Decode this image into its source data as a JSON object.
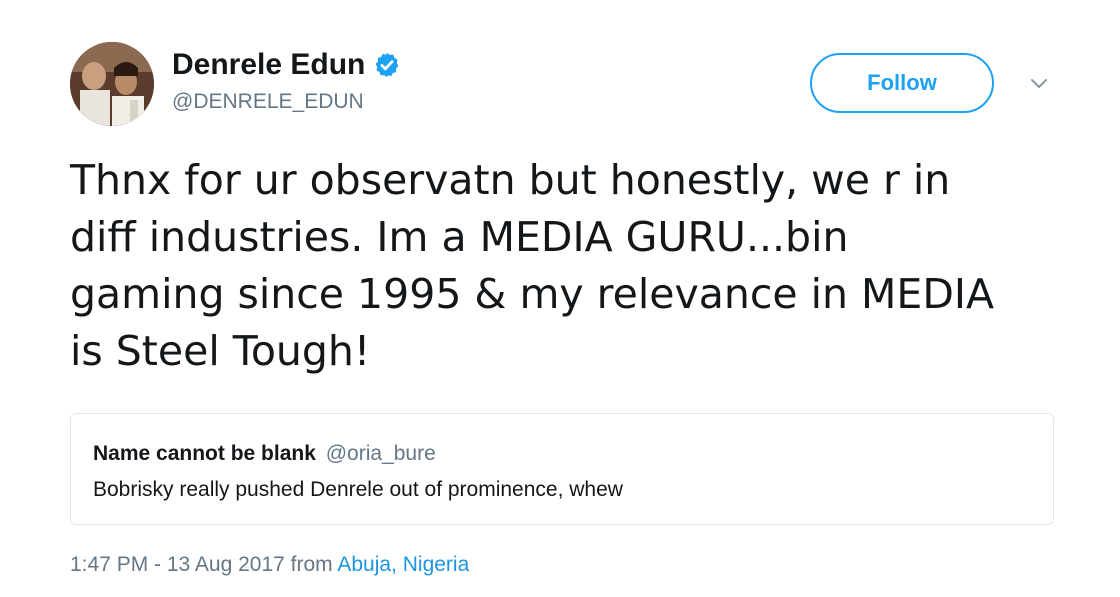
{
  "author": {
    "name": "Denrele Edun",
    "handle": "@DENRELE_EDUN",
    "verified": true
  },
  "actions": {
    "follow_label": "Follow",
    "menu_icon": "chevron-down-icon"
  },
  "tweet": {
    "lines": [
      "Thnx for ur observatn but honestly, we r in",
      "diff industries. Im a MEDIA GURU...bin",
      "gaming since 1995 & my relevance in MEDIA",
      "is Steel Tough!"
    ]
  },
  "quoted_tweet": {
    "name": "Name cannot be blank",
    "handle": "@oria_bure",
    "text": "Bobrisky really pushed Denrele out of prominence, whew"
  },
  "meta": {
    "time": "1:47 PM - 13 Aug 2017",
    "from_label": "from",
    "location": "Abuja, Nigeria"
  },
  "colors": {
    "accent": "#1da1f2",
    "link": "#1b95e0",
    "secondary_text": "#657786",
    "border": "#e1e8ed"
  }
}
